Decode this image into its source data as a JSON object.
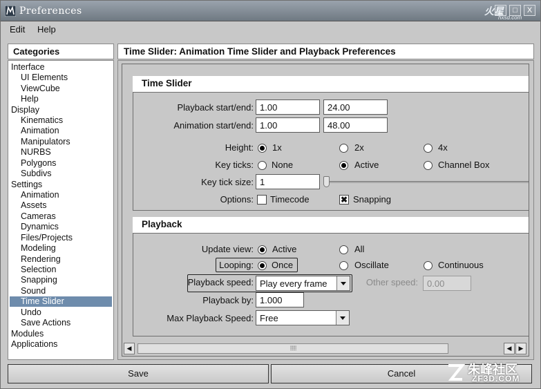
{
  "window": {
    "title": "Preferences",
    "minimize": "_",
    "maximize": "□",
    "close": "X",
    "watermark_top": "火星",
    "watermark_sub": "hxsd.com"
  },
  "menubar": {
    "items": [
      "Edit",
      "Help"
    ]
  },
  "categories": {
    "header": "Categories",
    "items": [
      "Interface",
      "UI Elements",
      "ViewCube",
      "Help",
      "Display",
      "Kinematics",
      "Animation",
      "Manipulators",
      "NURBS",
      "Polygons",
      "Subdivs",
      "Settings",
      "Animation",
      "Assets",
      "Cameras",
      "Dynamics",
      "Files/Projects",
      "Modeling",
      "Rendering",
      "Selection",
      "Snapping",
      "Sound",
      "Time Slider",
      "Undo",
      "Save Actions",
      "Modules",
      "Applications"
    ],
    "selected": "Time Slider"
  },
  "panel": {
    "title": "Time Slider: Animation Time Slider and Playback Preferences"
  },
  "time_slider": {
    "heading": "Time Slider",
    "playback_label": "Playback start/end:",
    "playback_start": "1.00",
    "playback_end": "24.00",
    "animation_label": "Animation start/end:",
    "animation_start": "1.00",
    "animation_end": "48.00",
    "height_label": "Height:",
    "height_options": [
      "1x",
      "2x",
      "4x"
    ],
    "height_selected": "1x",
    "keyticks_label": "Key ticks:",
    "keyticks_options": [
      "None",
      "Active",
      "Channel Box"
    ],
    "keyticks_selected": "Active",
    "keytick_size_label": "Key tick size:",
    "keytick_size": "1",
    "options_label": "Options:",
    "timecode_label": "Timecode",
    "timecode_checked": false,
    "snapping_label": "Snapping",
    "snapping_checked": true,
    "check_mark": "✖"
  },
  "playback": {
    "heading": "Playback",
    "update_view_label": "Update view:",
    "update_view_options": [
      "Active",
      "All"
    ],
    "update_view_selected": "Active",
    "looping_label": "Looping:",
    "looping_options": [
      "Once",
      "Oscillate",
      "Continuous"
    ],
    "looping_selected": "Once",
    "speed_label": "Playback speed:",
    "speed_value": "Play every frame",
    "other_speed_label": "Other speed:",
    "other_speed_value": "0.00",
    "by_label": "Playback by:",
    "by_value": "1.000",
    "max_speed_label": "Max Playback Speed:",
    "max_speed_value": "Free"
  },
  "scrollbar": {
    "left": "◀",
    "right": "▶",
    "grip": "⁞⁞⁞⁞⁞⁞"
  },
  "buttons": {
    "save": "Save",
    "cancel": "Cancel"
  },
  "brand": {
    "name": "朱峰社区",
    "url": "ZF3D.COM"
  }
}
